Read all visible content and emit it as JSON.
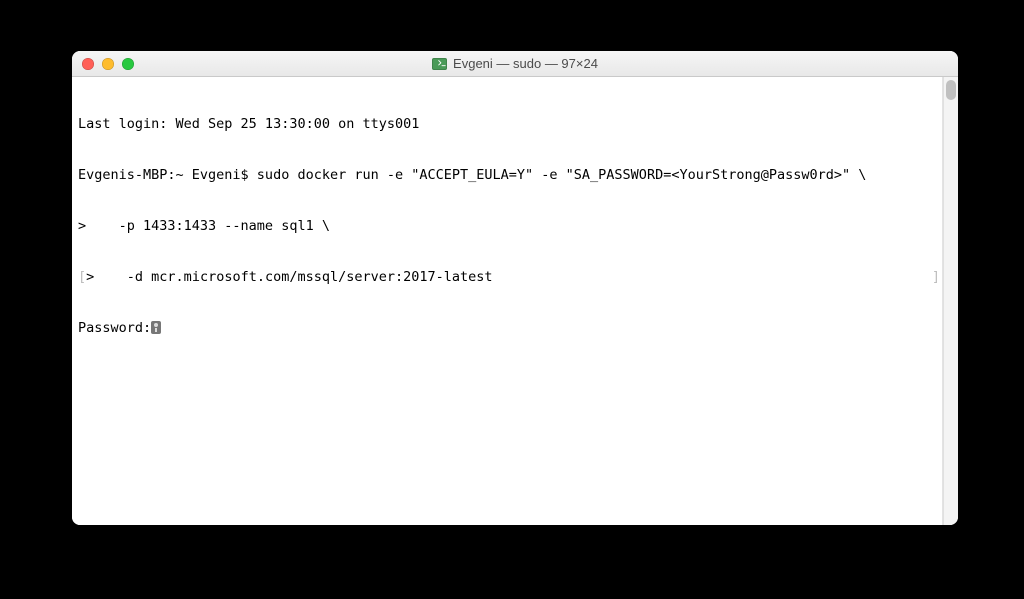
{
  "window": {
    "title": "Evgeni — sudo — 97×24",
    "icon_name": "terminal-app-icon"
  },
  "terminal": {
    "lines": {
      "l1": "Last login: Wed Sep 25 13:30:00 on ttys001",
      "l2": "Evgenis-MBP:~ Evgeni$ sudo docker run -e \"ACCEPT_EULA=Y\" -e \"SA_PASSWORD=<YourStrong@Passw0rd>\" \\",
      "l3": ">    -p 1433:1433 --name sql1 \\",
      "l4_prefix": ">",
      "l4_rest": "    -d mcr.microsoft.com/mssql/server:2017-latest",
      "l5_label": "Password:",
      "l5_icon": "key-icon",
      "right_bracket": "]",
      "left_bracket": "["
    }
  }
}
